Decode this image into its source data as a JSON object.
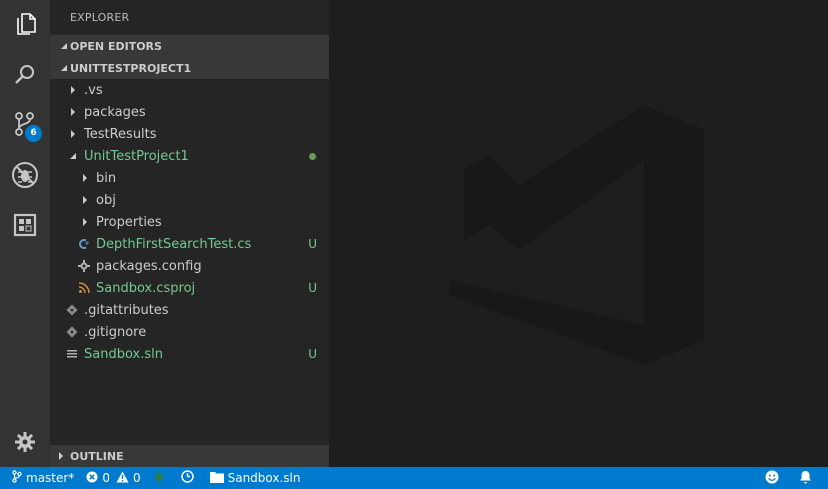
{
  "sidebar": {
    "title": "EXPLORER",
    "sections": {
      "open_editors": "OPEN EDITORS",
      "project": "UNITTESTPROJECT1",
      "outline": "OUTLINE"
    },
    "tree": [
      {
        "label": ".vs",
        "status": ""
      },
      {
        "label": "packages",
        "status": ""
      },
      {
        "label": "TestResults",
        "status": ""
      },
      {
        "label": "UnitTestProject1",
        "status": "dot"
      },
      {
        "label": "bin",
        "status": ""
      },
      {
        "label": "obj",
        "status": ""
      },
      {
        "label": "Properties",
        "status": ""
      },
      {
        "label": "DepthFirstSearchTest.cs",
        "status": "U"
      },
      {
        "label": "packages.config",
        "status": ""
      },
      {
        "label": "Sandbox.csproj",
        "status": "U"
      },
      {
        "label": ".gitattributes",
        "status": ""
      },
      {
        "label": ".gitignore",
        "status": ""
      },
      {
        "label": "Sandbox.sln",
        "status": "U"
      }
    ]
  },
  "activity_bar": {
    "scm_badge": "6",
    "icons": [
      "files-icon",
      "search-icon",
      "source-control-icon",
      "debug-icon",
      "extensions-icon",
      "settings-gear-icon"
    ]
  },
  "statusbar": {
    "branch": "master*",
    "errors": "0",
    "warnings": "0",
    "solution": "Sandbox.sln"
  },
  "colors": {
    "accent": "#007acc",
    "untracked": "#73c991",
    "sidebar_bg": "#252526",
    "activity_bg": "#333333"
  }
}
